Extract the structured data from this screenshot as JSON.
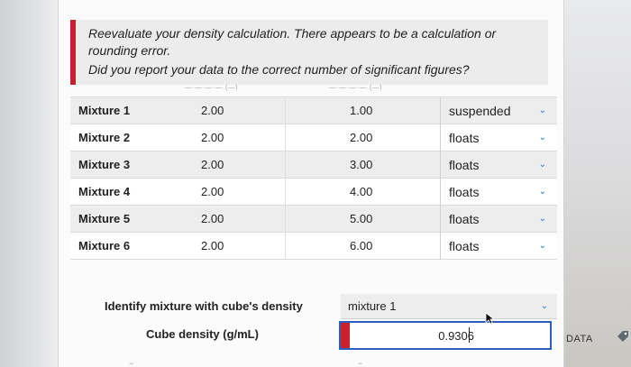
{
  "feedback": {
    "line1": "Reevaluate your density calculation. There appears to be a calculation or",
    "line2": "rounding error.",
    "line3": "Did you report your data to the correct number of significant figures?"
  },
  "table": {
    "rows": [
      {
        "name": "Mixture 1",
        "a": "2.00",
        "b": "1.00",
        "result": "suspended"
      },
      {
        "name": "Mixture 2",
        "a": "2.00",
        "b": "2.00",
        "result": "floats"
      },
      {
        "name": "Mixture 3",
        "a": "2.00",
        "b": "3.00",
        "result": "floats"
      },
      {
        "name": "Mixture 4",
        "a": "2.00",
        "b": "4.00",
        "result": "floats"
      },
      {
        "name": "Mixture 5",
        "a": "2.00",
        "b": "5.00",
        "result": "floats"
      },
      {
        "name": "Mixture 6",
        "a": "2.00",
        "b": "6.00",
        "result": "floats"
      }
    ]
  },
  "identify": {
    "label": "Identify mixture with cube's density",
    "selected": "mixture 1"
  },
  "density": {
    "label": "Cube density (g/mL)",
    "value": "0.9306"
  },
  "data_button": "DATA",
  "colors": {
    "error_red": "#c8202f",
    "focus_blue": "#2c5dbf",
    "chevron_blue": "#2c72c4"
  },
  "icons": {
    "dropdown": "chevron-down-icon",
    "cursor": "mouse-pointer-icon",
    "tag": "tag-icon"
  }
}
